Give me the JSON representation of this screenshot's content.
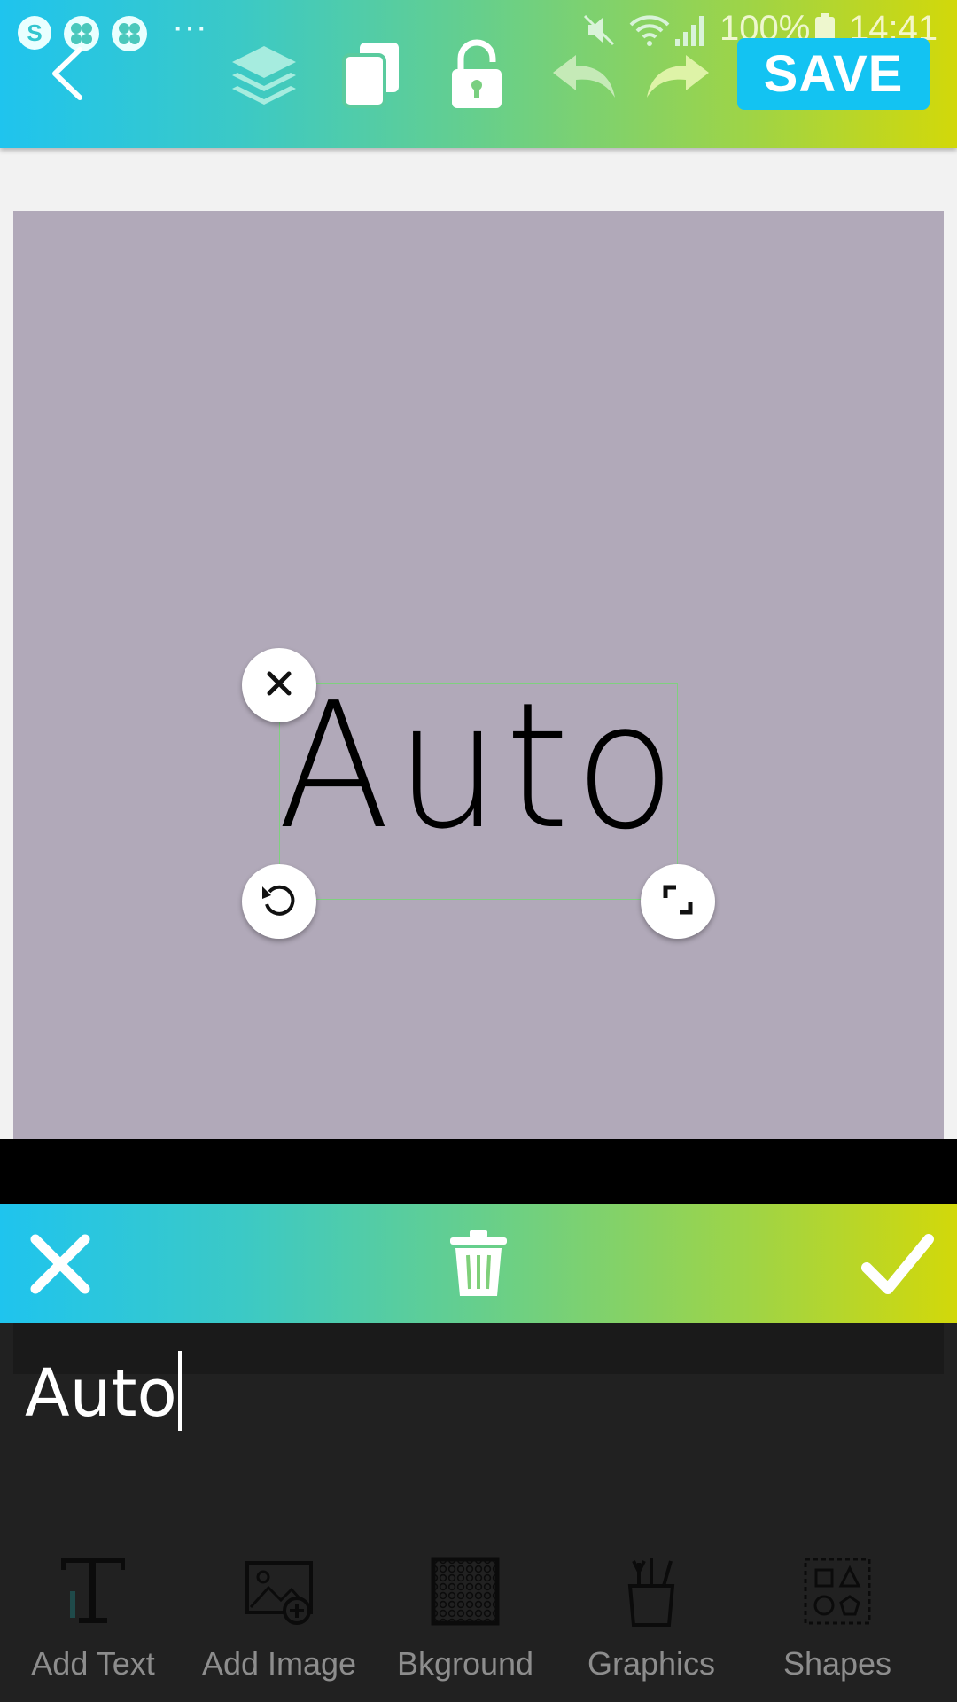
{
  "status_bar": {
    "battery": "100%",
    "time": "14:41",
    "more_dots": "···"
  },
  "toolbar": {
    "back_icon": "chevron-left-icon",
    "layers_icon": "layers-icon",
    "duplicate_icon": "copy-icon",
    "lock_icon": "unlock-icon",
    "undo_icon": "undo-icon",
    "redo_icon": "redo-icon",
    "save_label": "SAVE"
  },
  "canvas": {
    "background_color": "#b1a9b9",
    "text": "Auto",
    "handles": [
      "close-icon",
      "rotate-icon",
      "resize-icon"
    ]
  },
  "edit_bar": {
    "cancel_icon": "close-icon",
    "delete_icon": "trash-icon",
    "confirm_icon": "checkmark-icon"
  },
  "text_input": {
    "value": "Auto"
  },
  "bottom_nav": [
    {
      "label": "Add Text",
      "icon": "text-icon"
    },
    {
      "label": "Add Image",
      "icon": "add-image-icon"
    },
    {
      "label": "Bkground",
      "icon": "background-pattern-icon"
    },
    {
      "label": "Graphics",
      "icon": "brushes-icon"
    },
    {
      "label": "Shapes",
      "icon": "shapes-icon"
    }
  ],
  "colors": {
    "gradient_start": "#1fc4ee",
    "gradient_end": "#d2d80a",
    "save_button": "#13c3f2",
    "panel_dark": "#212121"
  }
}
